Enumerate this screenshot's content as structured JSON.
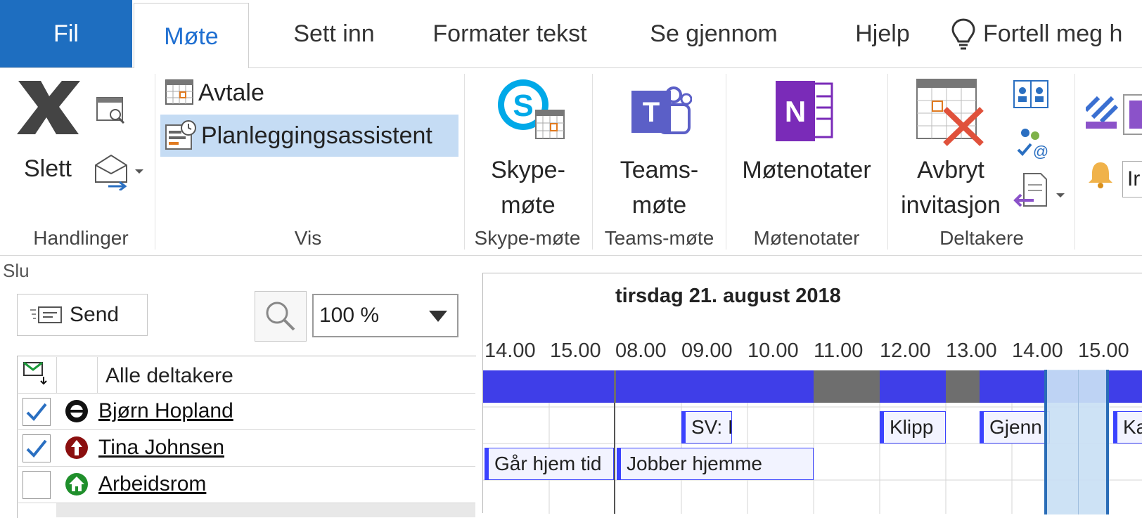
{
  "tabs": {
    "fil": "Fil",
    "mote": "Møte",
    "sett_inn": "Sett inn",
    "formater": "Formater tekst",
    "se_gjennom": "Se gjennom",
    "hjelp": "Hjelp",
    "fortell": "Fortell meg h"
  },
  "ribbon": {
    "slett": "Slett",
    "avtale": "Avtale",
    "planlegging": "Planleggingsassistent",
    "skype_line1": "Skype-",
    "skype_line2": "møte",
    "teams_line1": "Teams-",
    "teams_line2": "møte",
    "motenotater": "Møtenotater",
    "avbryt_line1": "Avbryt",
    "avbryt_line2": "invitasjon",
    "partial_input": "Ir",
    "groups": {
      "handlinger": "Handlinger",
      "vis": "Vis",
      "skype": "Skype-møte",
      "teams": "Teams-møte",
      "motenotater": "Møtenotater",
      "deltakere": "Deltakere"
    }
  },
  "scheduler": {
    "cut_label": "Slu",
    "send_label": "Send",
    "zoom_value": "100 %",
    "date_header": "tirsdag 21. august 2018",
    "hours": [
      "14.00",
      "15.00",
      "08.00",
      "09.00",
      "10.00",
      "11.00",
      "12.00",
      "13.00",
      "14.00",
      "15.00"
    ],
    "all_attendees": "Alle deltakere",
    "attendees": [
      {
        "name": "Bjørn Hopland",
        "checked": true
      },
      {
        "name": "Tina Johnsen",
        "checked": true
      },
      {
        "name": "Arbeidsrom",
        "checked": false
      }
    ],
    "appointments": {
      "bjorn_1": "SV: I",
      "bjorn_2": "Klipp",
      "bjorn_3": "Gjenn",
      "bjorn_4": "Ka",
      "tina_1": "Går hjem tid",
      "tina_2": "Jobber hjemme"
    },
    "colors": {
      "busy": "#3f3ee8",
      "tentative_gray": "#6e6e6e",
      "selection": "#c9dff4",
      "selection_border": "#2a6db7"
    }
  }
}
